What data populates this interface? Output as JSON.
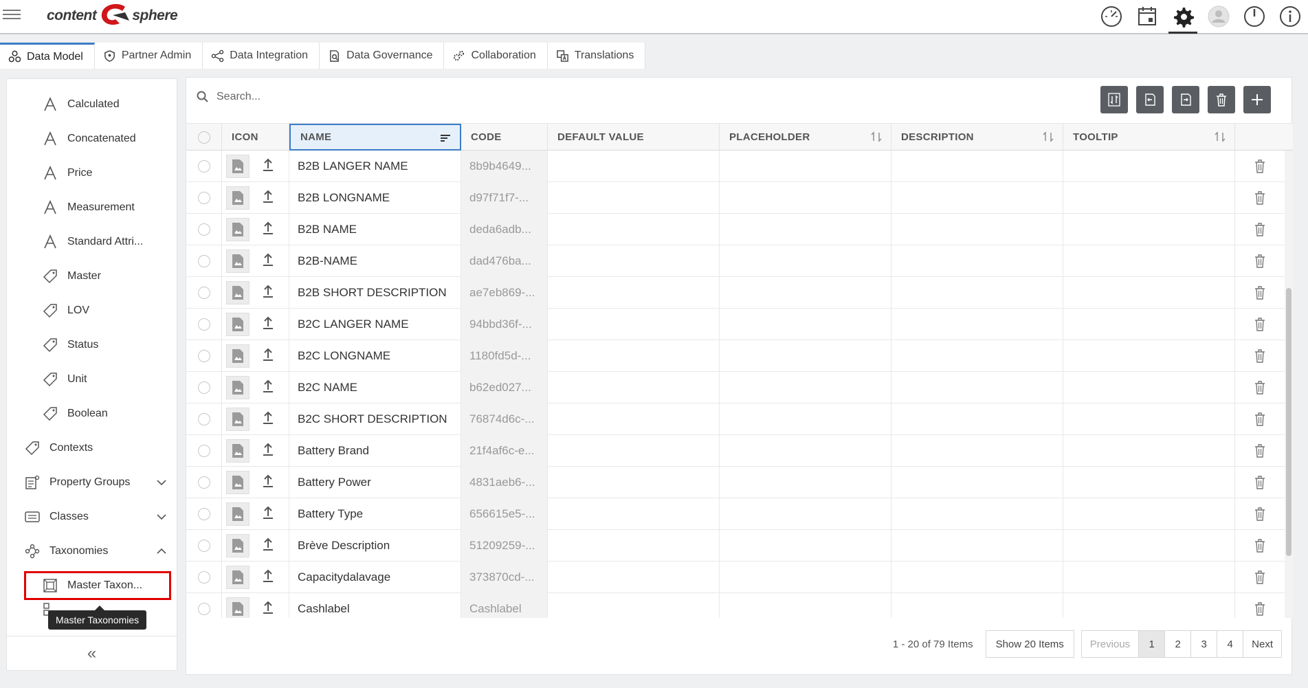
{
  "app": {
    "logo_left": "content",
    "logo_right": "sphere"
  },
  "topbar_icons": [
    "dashboard-icon",
    "calendar-icon",
    "settings-icon",
    "user-avatar-icon",
    "power-icon",
    "info-icon"
  ],
  "tabs": [
    {
      "label": "Data Model",
      "icon": "data-model-icon",
      "active": true
    },
    {
      "label": "Partner Admin",
      "icon": "shield-icon",
      "active": false
    },
    {
      "label": "Data Integration",
      "icon": "share-icon",
      "active": false
    },
    {
      "label": "Data Governance",
      "icon": "governance-icon",
      "active": false
    },
    {
      "label": "Collaboration",
      "icon": "gears-icon",
      "active": false
    },
    {
      "label": "Translations",
      "icon": "translate-icon",
      "active": false
    }
  ],
  "sidebar": {
    "items": [
      {
        "label": "Calculated",
        "icon": "attribute-a-icon"
      },
      {
        "label": "Concatenated",
        "icon": "attribute-a-icon"
      },
      {
        "label": "Price",
        "icon": "attribute-a-icon"
      },
      {
        "label": "Measurement",
        "icon": "attribute-a-icon"
      },
      {
        "label": "Standard Attri...",
        "icon": "attribute-a-icon"
      },
      {
        "label": "Master",
        "icon": "tag-icon"
      },
      {
        "label": "LOV",
        "icon": "tag-icon"
      },
      {
        "label": "Status",
        "icon": "tag-icon"
      },
      {
        "label": "Unit",
        "icon": "tag-icon"
      },
      {
        "label": "Boolean",
        "icon": "tag-icon"
      }
    ],
    "groups": [
      {
        "label": "Contexts",
        "icon": "tag-icon"
      },
      {
        "label": "Property Groups",
        "icon": "property-groups-icon"
      },
      {
        "label": "Classes",
        "icon": "classes-icon"
      },
      {
        "label": "Taxonomies",
        "icon": "taxonomies-icon"
      }
    ],
    "sub_items": [
      {
        "label": "Master Taxon...",
        "icon": "master-taxonomy-icon"
      }
    ],
    "tooltip": "Master Taxonomies",
    "collapse_label": "«"
  },
  "search": {
    "placeholder": "Search..."
  },
  "toolbar": [
    "sync-icon",
    "import-icon",
    "export-icon",
    "delete-icon",
    "add-icon"
  ],
  "table": {
    "columns": [
      "ICON",
      "NAME",
      "CODE",
      "DEFAULT VALUE",
      "PLACEHOLDER",
      "DESCRIPTION",
      "TOOLTIP"
    ],
    "rows": [
      {
        "name": "B2B LANGER NAME",
        "code": "8b9b4649..."
      },
      {
        "name": "B2B LONGNAME",
        "code": "d97f71f7-..."
      },
      {
        "name": "B2B NAME",
        "code": "deda6adb..."
      },
      {
        "name": "B2B-NAME",
        "code": "dad476ba..."
      },
      {
        "name": "B2B SHORT DESCRIPTION",
        "code": "ae7eb869-..."
      },
      {
        "name": "B2C LANGER NAME",
        "code": "94bbd36f-..."
      },
      {
        "name": "B2C LONGNAME",
        "code": "1180fd5d-..."
      },
      {
        "name": "B2C NAME",
        "code": "b62ed027..."
      },
      {
        "name": "B2C SHORT DESCRIPTION",
        "code": "76874d6c-..."
      },
      {
        "name": "Battery Brand",
        "code": "21f4af6c-e..."
      },
      {
        "name": "Battery Power",
        "code": "4831aeb6-..."
      },
      {
        "name": "Battery Type",
        "code": "656615e5-..."
      },
      {
        "name": " Brève Description",
        "code": "51209259-..."
      },
      {
        "name": "Capacitydalavage",
        "code": "373870cd-..."
      },
      {
        "name": "Cashlabel",
        "code": "Cashlabel"
      }
    ]
  },
  "pagination": {
    "range": "1 - 20 of 79 Items",
    "show": "Show 20 Items",
    "previous": "Previous",
    "pages": [
      "1",
      "2",
      "3",
      "4"
    ],
    "current_page": "1",
    "next": "Next"
  },
  "colors": {
    "accent": "#3b7cc7",
    "toolbar_button": "#5a5e63",
    "highlight": "#e00000",
    "logo_red": "#d0161b"
  }
}
